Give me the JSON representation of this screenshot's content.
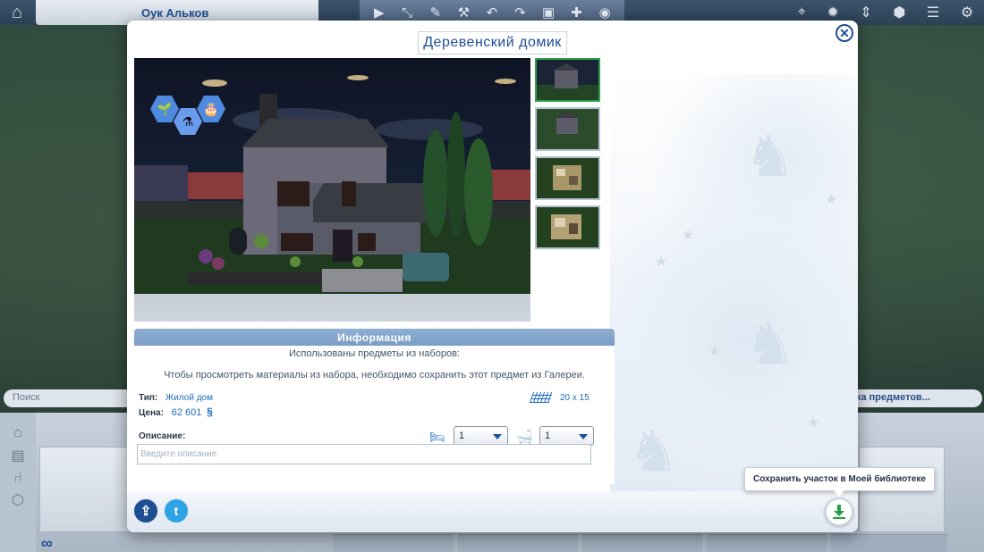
{
  "background": {
    "lot_name": "Оук Альков",
    "search_placeholder": "Поиск",
    "search_right_text": "ка предметов..."
  },
  "modal": {
    "title": "Деревенский домик",
    "info": {
      "header": "Информация",
      "packs_used": "Использованы предметы из наборов:",
      "gallery_notice": "Чтобы просмотреть материалы из набора, необходимо сохранить этот предмет из Галереи.",
      "type_label": "Тип:",
      "type_value": "Жилой дом",
      "price_label": "Цена:",
      "price_value": "62 601",
      "currency_symbol": "§",
      "lot_size": "20 x 15",
      "bedrooms": "1",
      "bathrooms": "1",
      "description_label": "Описание:",
      "description_placeholder": "Введите описание"
    },
    "tooltip": "Сохранить участок в Моей библиотеке"
  },
  "colors": {
    "brand_blue": "#1e4f93",
    "info_header": "#7a9dc5",
    "save_green": "#25a244",
    "twitter": "#2fa3e6"
  },
  "icons": {
    "close": "close-icon",
    "upload": "upload-icon",
    "twitter": "twitter-icon",
    "save": "download-icon",
    "bed": "bed-icon",
    "bath": "bath-icon",
    "lot_size": "grid-icon"
  }
}
